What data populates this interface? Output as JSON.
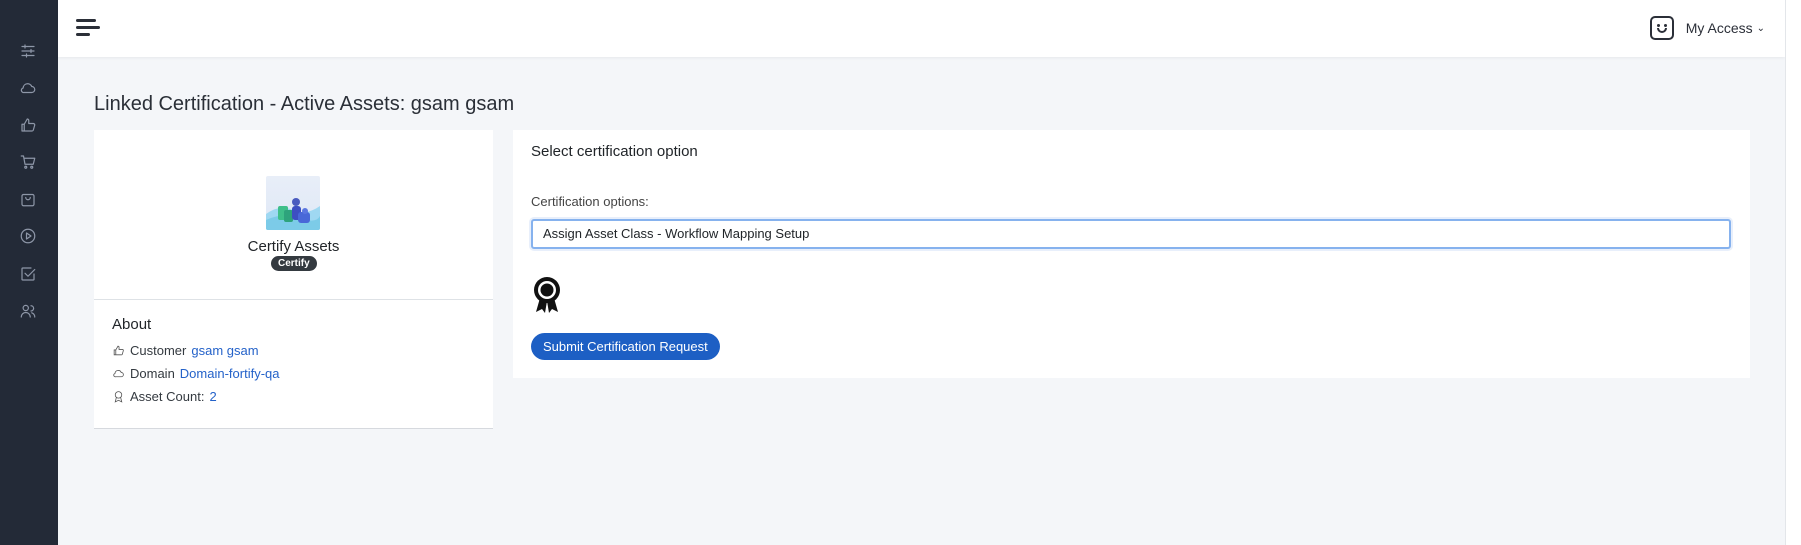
{
  "sidebar": {
    "icons": [
      "sliders-icon",
      "cloud-icon",
      "thumbs-up-icon",
      "cart-icon",
      "bag-icon",
      "play-icon",
      "check-square-icon",
      "users-icon"
    ]
  },
  "header": {
    "user_label": "My Access"
  },
  "page": {
    "title": "Linked Certification - Active Assets: gsam gsam"
  },
  "asset": {
    "name": "Certify Assets",
    "badge": "Certify"
  },
  "about": {
    "heading": "About",
    "customer_label": "Customer",
    "customer_value": "gsam gsam",
    "domain_label": "Domain",
    "domain_value": "Domain-fortify-qa",
    "asset_count_label": "Asset Count:",
    "asset_count_value": "2"
  },
  "certification": {
    "heading": "Select certification option",
    "options_label": "Certification options:",
    "selected_option": "Assign Asset Class - Workflow Mapping Setup",
    "submit_label": "Submit Certification Request"
  }
}
